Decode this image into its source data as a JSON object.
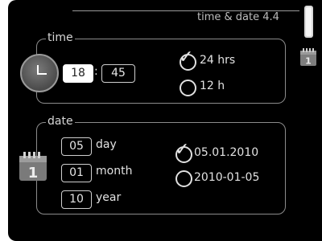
{
  "header": {
    "title": "time & date 4.4"
  },
  "time": {
    "label": "time",
    "hours": "18",
    "separator": ":",
    "minutes": "45",
    "format_options": [
      {
        "label": "24 hrs",
        "selected": true
      },
      {
        "label": "12 h",
        "selected": false
      }
    ]
  },
  "date": {
    "label": "date",
    "day_value": "05",
    "day_label": "day",
    "month_value": "01",
    "month_label": "month",
    "year_value": "10",
    "year_label": "year",
    "format_options": [
      {
        "label": "05.01.2010",
        "selected": true
      },
      {
        "label": "2010-01-05",
        "selected": false
      }
    ]
  },
  "icons": {
    "calendar_digit": "1"
  }
}
